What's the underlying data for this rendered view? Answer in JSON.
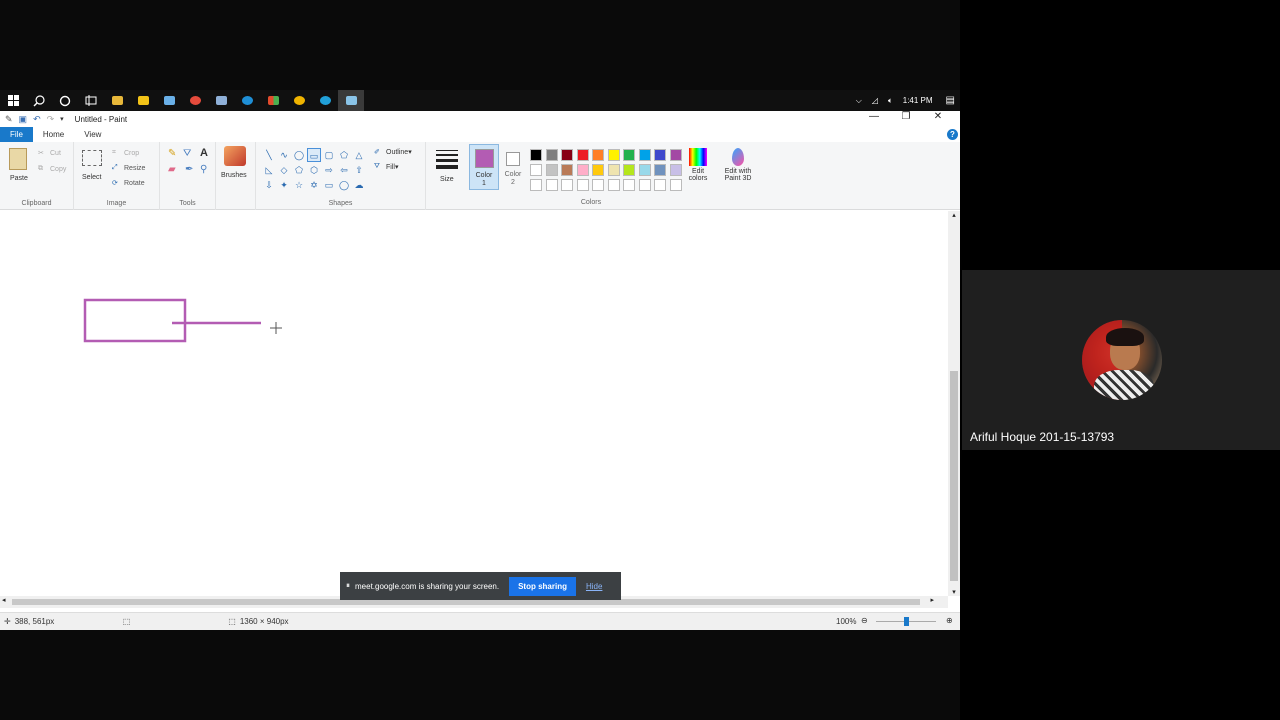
{
  "taskbar": {
    "clock": "1:41 PM"
  },
  "window": {
    "title": "Untitled - Paint"
  },
  "tabs": [
    "File",
    "Home",
    "View"
  ],
  "ribbon": {
    "clipboard": {
      "paste": "Paste",
      "cut": "Cut",
      "copy": "Copy",
      "label": "Clipboard"
    },
    "image": {
      "select": "Select",
      "crop": "Crop",
      "resize": "Resize",
      "rotate": "Rotate",
      "label": "Image"
    },
    "tools": {
      "label": "Tools"
    },
    "brushes": {
      "label": "Brushes"
    },
    "shapes": {
      "outline": "Outline",
      "fill": "Fill",
      "label": "Shapes"
    },
    "size": {
      "label": "Size"
    },
    "color1": {
      "label": "Color",
      "num": "1",
      "value": "#b35cb3"
    },
    "color2": {
      "label": "Color",
      "num": "2",
      "value": "#ffffff"
    },
    "colors": {
      "label": "Colors",
      "palette": [
        "#000000",
        "#7f7f7f",
        "#880015",
        "#ed1c24",
        "#ff7f27",
        "#fff200",
        "#22b14c",
        "#00a2e8",
        "#3f48cc",
        "#a349a4",
        "#ffffff",
        "#c3c3c3",
        "#b97a57",
        "#ffaec9",
        "#ffc90e",
        "#efe4b0",
        "#b5e61d",
        "#99d9ea",
        "#7092be",
        "#c8bfe7",
        "#ffffff",
        "#ffffff",
        "#ffffff",
        "#ffffff",
        "#ffffff",
        "#ffffff",
        "#ffffff",
        "#ffffff",
        "#ffffff",
        "#ffffff"
      ]
    },
    "edit_colors": {
      "line1": "Edit",
      "line2": "colors"
    },
    "paint3d": {
      "line1": "Edit with",
      "line2": "Paint 3D"
    }
  },
  "canvas": {
    "stroke_color": "#b35cb3"
  },
  "statusbar": {
    "cursor_pos": "388, 561px",
    "image_size": "1360 × 940px",
    "zoom": "100%",
    "zoom_fraction": 0.5
  },
  "toast": {
    "message": "meet.google.com is sharing your screen.",
    "stop": "Stop sharing",
    "hide": "Hide"
  },
  "participant": {
    "name": "Ariful Hoque 201-15-13793"
  }
}
